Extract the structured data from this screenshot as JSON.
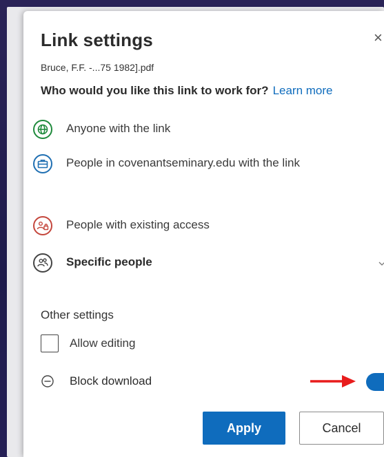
{
  "dialog": {
    "title": "Link settings",
    "close_glyph": "×",
    "filename": "Bruce, F.F. -...75 1982].pdf",
    "question": "Who would you like this link to work for?",
    "learn_more": "Learn more"
  },
  "options": [
    {
      "label": "Anyone with the link",
      "icon": "globe-icon",
      "color": "#1f8a3c"
    },
    {
      "label": "People in covenantseminary.edu with the link",
      "icon": "briefcase-icon",
      "color": "#1f6fb2"
    },
    {
      "label": "People with existing access",
      "icon": "people-lock-icon",
      "color": "#c4463c"
    },
    {
      "label": "Specific people",
      "icon": "people-icon",
      "color": "#444444"
    }
  ],
  "other_settings": {
    "heading": "Other settings",
    "allow_editing": {
      "label": "Allow editing",
      "checked": false
    },
    "block_download": {
      "label": "Block download",
      "enabled": true
    }
  },
  "buttons": {
    "apply": "Apply",
    "cancel": "Cancel"
  },
  "colors": {
    "accent": "#0f6cbd",
    "annotation_arrow": "#e81c1c"
  }
}
